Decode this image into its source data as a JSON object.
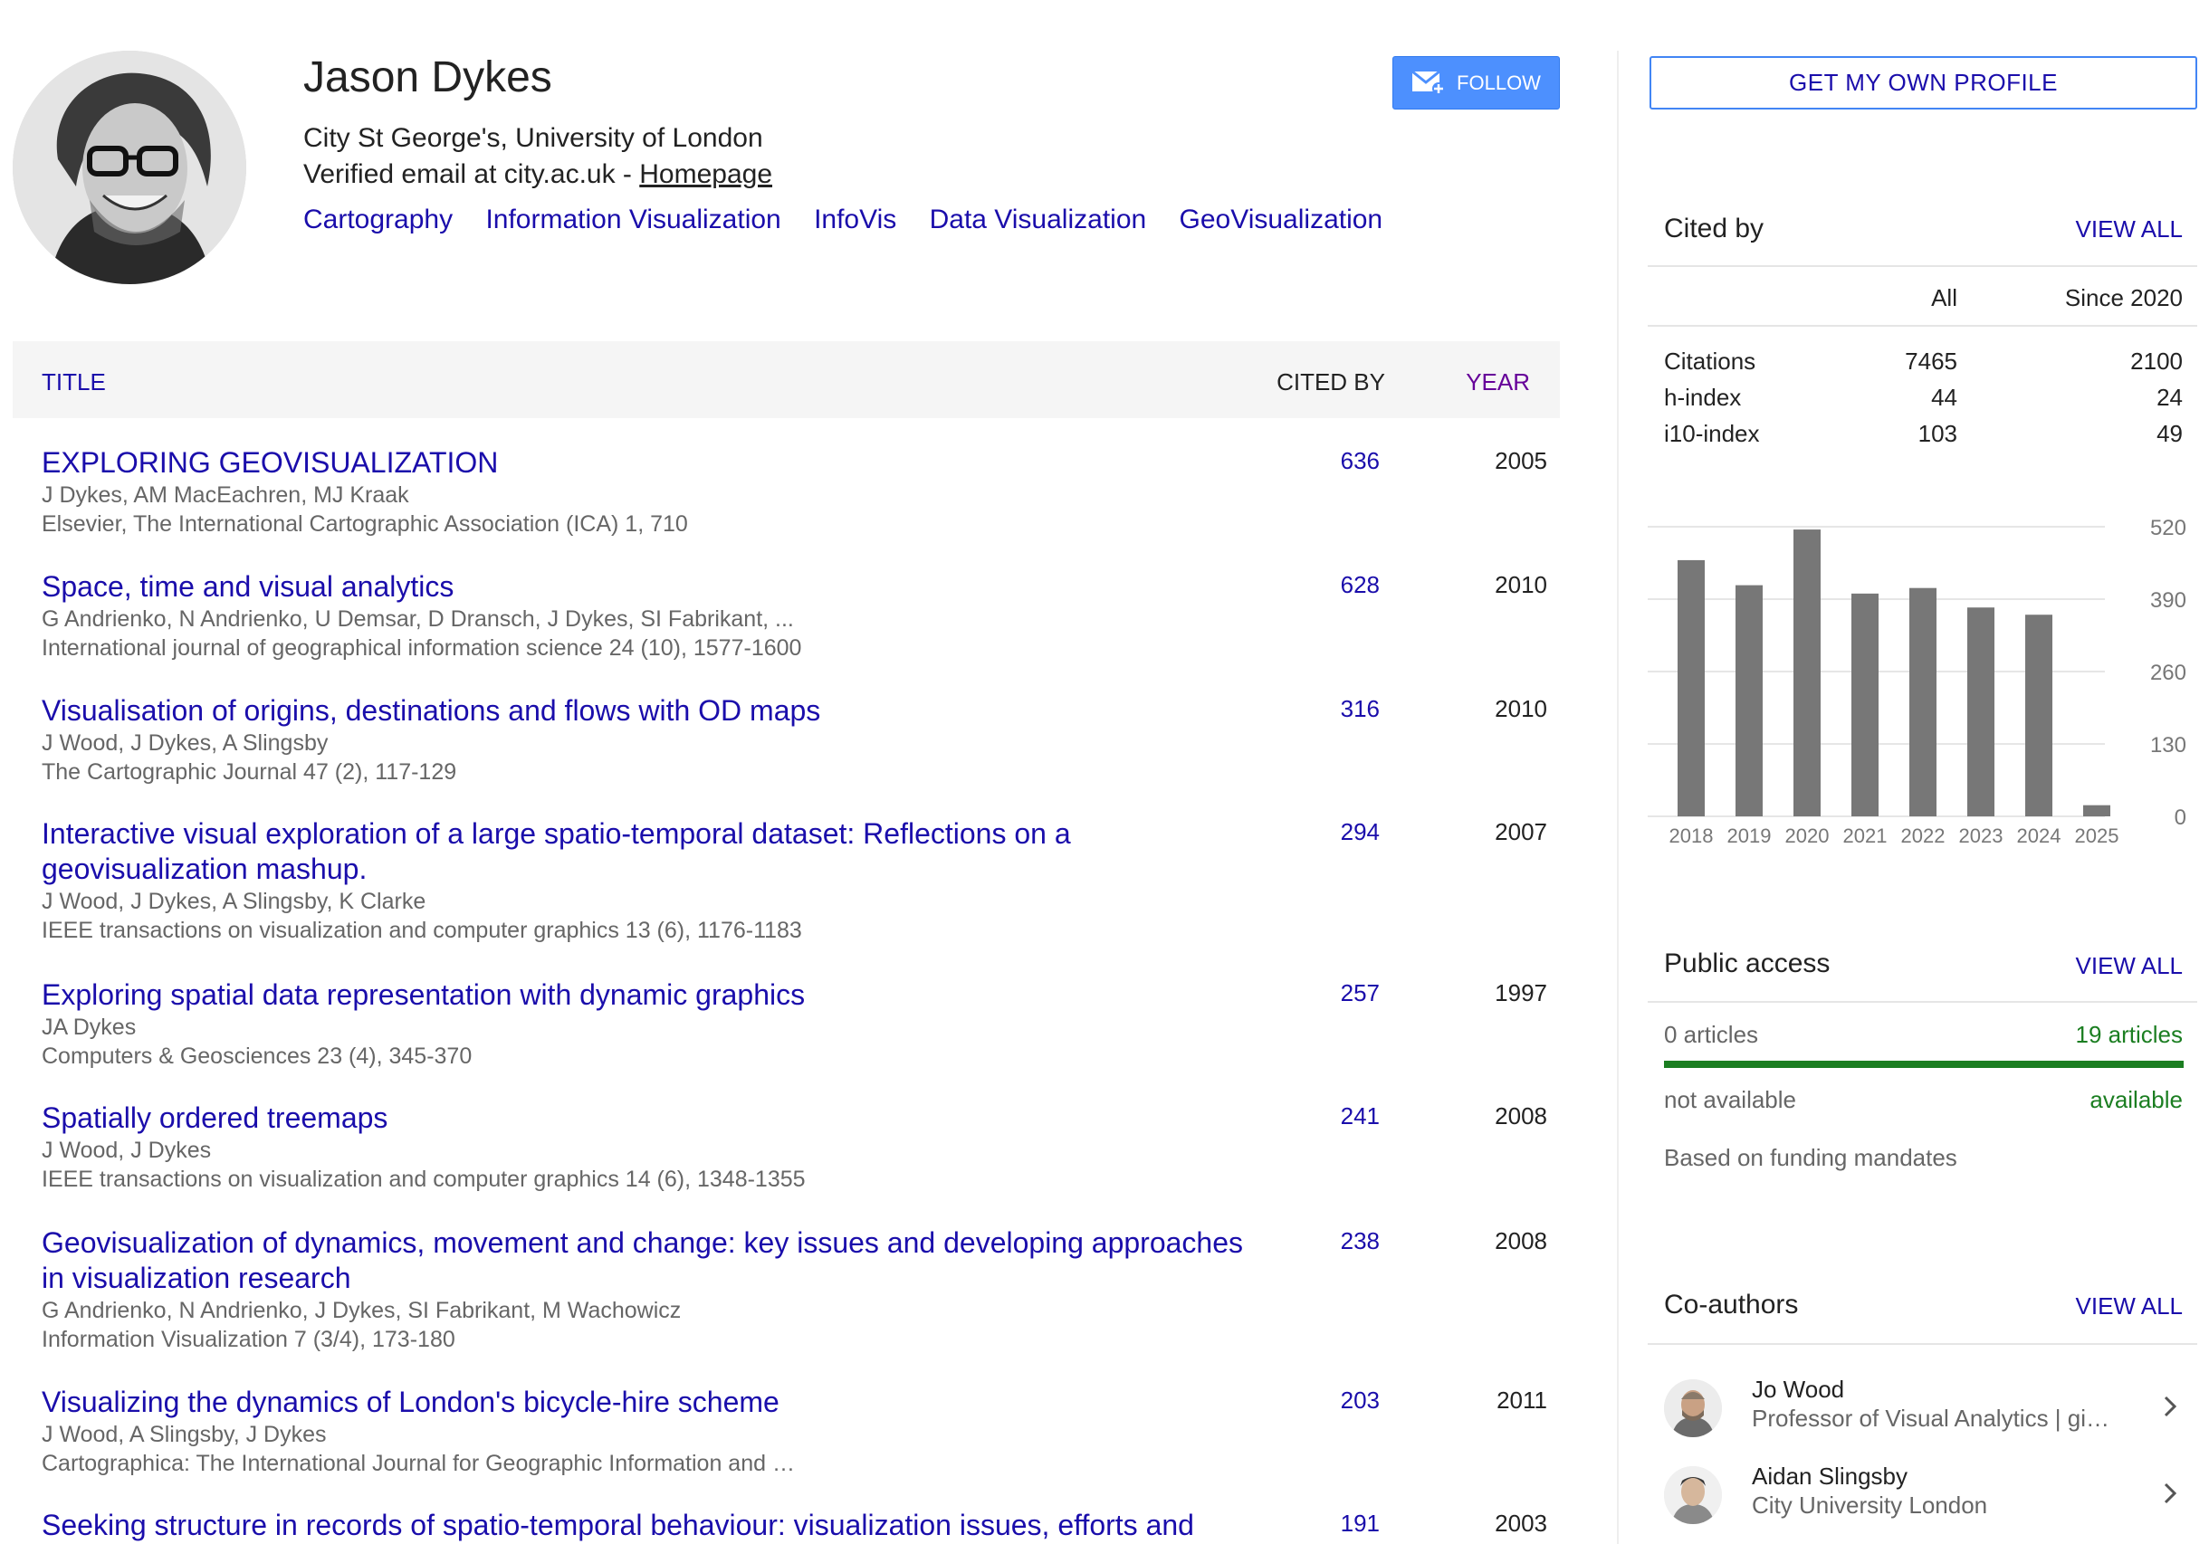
{
  "profile": {
    "name": "Jason Dykes",
    "affiliation": "City St George's, University of London",
    "email_text": "Verified email at city.ac.uk - ",
    "homepage_label": "Homepage",
    "interests": [
      "Cartography",
      "Information Visualization",
      "InfoVis",
      "Data Visualization",
      "GeoVisualization"
    ],
    "follow_label": "FOLLOW"
  },
  "table": {
    "headers": {
      "title": "TITLE",
      "cited_by": "CITED BY",
      "year": "YEAR"
    },
    "articles": [
      {
        "title": "EXPLORING GEOVISUALIZATION",
        "authors": "J Dykes, AM MacEachren, MJ Kraak",
        "venue": "Elsevier, The International Cartographic Association (ICA) 1, 710",
        "cited_by": "636",
        "year": "2005"
      },
      {
        "title": "Space, time and visual analytics",
        "authors": "G Andrienko, N Andrienko, U Demsar, D Dransch, J Dykes, SI Fabrikant, ...",
        "venue": "International journal of geographical information science 24 (10), 1577-1600",
        "cited_by": "628",
        "year": "2010"
      },
      {
        "title": "Visualisation of origins, destinations and flows with OD maps",
        "authors": "J Wood, J Dykes, A Slingsby",
        "venue": "The Cartographic Journal 47 (2), 117-129",
        "cited_by": "316",
        "year": "2010"
      },
      {
        "title": "Interactive visual exploration of a large spatio-temporal dataset: Reflections on a geovisualization mashup.",
        "authors": "J Wood, J Dykes, A Slingsby, K Clarke",
        "venue": "IEEE transactions on visualization and computer graphics 13 (6), 1176-1183",
        "cited_by": "294",
        "year": "2007"
      },
      {
        "title": "Exploring spatial data representation with dynamic graphics",
        "authors": "JA Dykes",
        "venue": "Computers & Geosciences 23 (4), 345-370",
        "cited_by": "257",
        "year": "1997"
      },
      {
        "title": "Spatially ordered treemaps",
        "authors": "J Wood, J Dykes",
        "venue": "IEEE transactions on visualization and computer graphics 14 (6), 1348-1355",
        "cited_by": "241",
        "year": "2008"
      },
      {
        "title": "Geovisualization of dynamics, movement and change: key issues and developing approaches in visualization research",
        "authors": "G Andrienko, N Andrienko, J Dykes, SI Fabrikant, M Wachowicz",
        "venue": "Information Visualization 7 (3/4), 173-180",
        "cited_by": "238",
        "year": "2008"
      },
      {
        "title": "Visualizing the dynamics of London's bicycle-hire scheme",
        "authors": "J Wood, A Slingsby, J Dykes",
        "venue": "Cartographica: The International Journal for Geographic Information and …",
        "cited_by": "203",
        "year": "2011"
      },
      {
        "title": "Seeking structure in records of spatio-temporal behaviour: visualization issues, efforts and",
        "authors": "",
        "venue": "",
        "cited_by": "191",
        "year": "2003"
      }
    ]
  },
  "sidebar": {
    "own_profile_label": "GET MY OWN PROFILE",
    "cited_by": {
      "title": "Cited by",
      "view_all": "VIEW ALL",
      "col_all": "All",
      "col_since": "Since 2020",
      "rows": [
        {
          "label": "Citations",
          "all": "7465",
          "since": "2100"
        },
        {
          "label": "h-index",
          "all": "44",
          "since": "24"
        },
        {
          "label": "i10-index",
          "all": "103",
          "since": "49"
        }
      ]
    },
    "public_access": {
      "title": "Public access",
      "view_all": "VIEW ALL",
      "not_available_count": "0 articles",
      "available_count": "19 articles",
      "not_available_label": "not available",
      "available_label": "available",
      "note": "Based on funding mandates",
      "available_fraction": 1.0
    },
    "coauthors": {
      "title": "Co-authors",
      "view_all": "VIEW ALL",
      "items": [
        {
          "name": "Jo Wood",
          "desc": "Professor of Visual Analytics | giCentre"
        },
        {
          "name": "Aidan Slingsby",
          "desc": "City University London"
        }
      ]
    }
  },
  "colors": {
    "link": "#1a0dab",
    "accent": "#4d90fe",
    "bar": "#777777",
    "available": "#1b7e21"
  },
  "chart_data": {
    "type": "bar",
    "categories": [
      "2018",
      "2019",
      "2020",
      "2021",
      "2022",
      "2023",
      "2024",
      "2025"
    ],
    "values": [
      460,
      415,
      515,
      400,
      410,
      375,
      362,
      20
    ],
    "yticks": [
      "520",
      "390",
      "260",
      "130",
      "0"
    ],
    "ylim": [
      0,
      520
    ],
    "grid": true
  }
}
